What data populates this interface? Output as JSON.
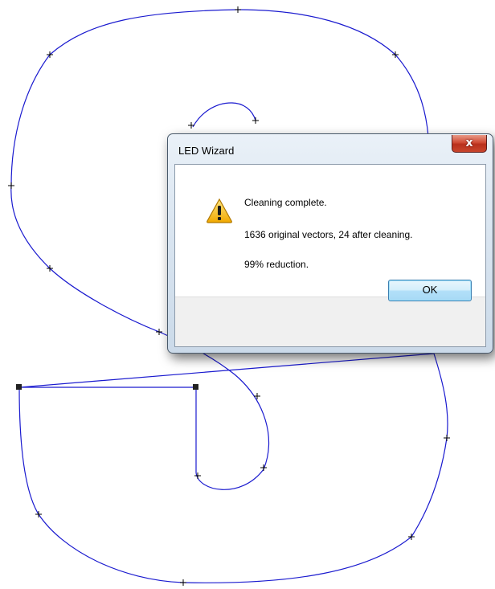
{
  "dialog": {
    "title": "LED Wizard",
    "close_label": "x",
    "icon": "warning-icon",
    "messages": [
      "Cleaning complete.",
      "1636 original vectors, 24 after cleaning.",
      "99% reduction."
    ],
    "ok_label": "OK"
  },
  "canvas": {
    "path_color": "#1a1acf",
    "node_color": "#000000"
  }
}
